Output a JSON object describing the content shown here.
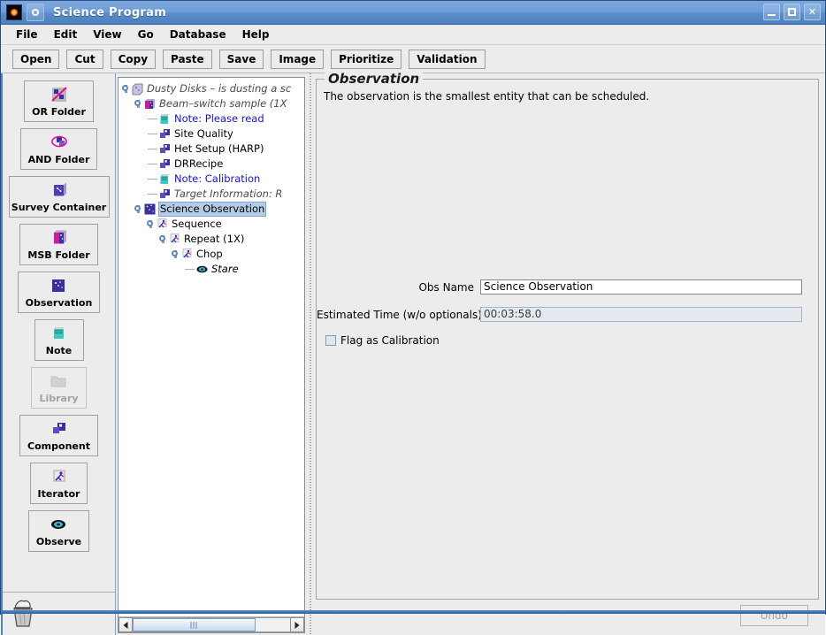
{
  "window": {
    "title": "Science Program",
    "app_icon": "star-icon",
    "menu_icon": "window-menu-icon",
    "buttons": [
      {
        "name": "minimize-button",
        "glyph": "minimize-icon",
        "label": ""
      },
      {
        "name": "maximize-button",
        "glyph": "maximize-icon",
        "label": ""
      },
      {
        "name": "close-button",
        "glyph": "close-icon",
        "label": "✕"
      }
    ]
  },
  "menubar": {
    "items": [
      "File",
      "Edit",
      "View",
      "Go",
      "Database",
      "Help"
    ]
  },
  "toolbar": {
    "buttons": [
      "Open",
      "Cut",
      "Copy",
      "Paste",
      "Save",
      "Image",
      "Prioritize",
      "Validation"
    ]
  },
  "palette": {
    "items": [
      {
        "label": "OR Folder",
        "icon": "or-folder-icon",
        "state": "normal"
      },
      {
        "label": "AND Folder",
        "icon": "and-folder-icon",
        "state": "normal"
      },
      {
        "label": "Survey Container",
        "icon": "survey-container-icon",
        "state": "selected"
      },
      {
        "label": "MSB Folder",
        "icon": "msb-folder-icon",
        "state": "normal"
      },
      {
        "label": "Observation",
        "icon": "observation-icon",
        "state": "normal"
      },
      {
        "label": "Note",
        "icon": "note-icon",
        "state": "normal"
      },
      {
        "label": "Library",
        "icon": "library-folder-icon",
        "state": "disabled"
      },
      {
        "label": "Component",
        "icon": "component-icon",
        "state": "normal"
      },
      {
        "label": "Iterator",
        "icon": "iterator-icon",
        "state": "normal"
      },
      {
        "label": "Observe",
        "icon": "observe-eye-icon",
        "state": "normal"
      }
    ],
    "trash": {
      "name": "trash-icon",
      "label": ""
    }
  },
  "tree": {
    "nodes": [
      {
        "label": "Dusty Disks – is dusting a sc",
        "depth": 0,
        "icon": "science-program-icon",
        "style": "italic-grey",
        "handle": "expanded"
      },
      {
        "label": "Beam–switch sample (1X",
        "depth": 1,
        "icon": "msb-folder-icon",
        "style": "italic-grey",
        "handle": "expanded"
      },
      {
        "label": "Note: Please read",
        "depth": 2,
        "icon": "note-icon",
        "style": "note",
        "handle": "leaf"
      },
      {
        "label": "Site Quality",
        "depth": 2,
        "icon": "component-icon",
        "style": "normal",
        "handle": "leaf"
      },
      {
        "label": "Het Setup (HARP)",
        "depth": 2,
        "icon": "component-icon",
        "style": "normal",
        "handle": "leaf"
      },
      {
        "label": "DRRecipe",
        "depth": 2,
        "icon": "component-icon",
        "style": "normal",
        "handle": "leaf"
      },
      {
        "label": "Note: Calibration",
        "depth": 2,
        "icon": "note-icon",
        "style": "note",
        "handle": "leaf"
      },
      {
        "label": "Target Information: R",
        "depth": 2,
        "icon": "component-icon",
        "style": "italic-grey",
        "handle": "leaf"
      },
      {
        "label": "Science Observation",
        "depth": 2,
        "icon": "observation-icon",
        "style": "selected",
        "handle": "expanded"
      },
      {
        "label": "Sequence",
        "depth": 3,
        "icon": "iterator-icon",
        "style": "normal",
        "handle": "expanded"
      },
      {
        "label": "Repeat (1X)",
        "depth": 4,
        "icon": "iterator-icon",
        "style": "normal",
        "handle": "expanded"
      },
      {
        "label": "Chop",
        "depth": 5,
        "icon": "iterator-icon",
        "style": "normal",
        "handle": "expanded"
      },
      {
        "label": "Stare",
        "depth": 6,
        "icon": "observe-eye-icon",
        "style": "italic",
        "handle": "leaf"
      }
    ],
    "scrollbar": {
      "left_arrow": "scroll-left-icon",
      "right_arrow": "scroll-right-icon"
    }
  },
  "detail": {
    "group_title": "Observation",
    "description": "The observation is the smallest entity that can be scheduled.",
    "fields": [
      {
        "label": "Obs Name",
        "value": "Science Observation",
        "readonly": false
      },
      {
        "label": "Estimated Time (w/o optionals)",
        "value": "00:03:58.0",
        "readonly": true
      }
    ],
    "checkbox": {
      "label": "Flag as Calibration",
      "checked": false
    }
  },
  "footer": {
    "undo_label": "Undo"
  },
  "colors": {
    "titlebar": "#5a8cc9",
    "panel_bg": "#ececec",
    "tree_bg": "#ffffff",
    "selection": "#b3cde8",
    "note_text": "#1414d6",
    "accent_icon": "#3a2f9e"
  }
}
